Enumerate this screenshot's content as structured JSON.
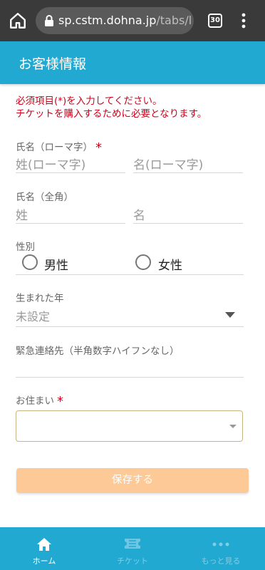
{
  "browser": {
    "url_host": "sp.cstm.dohna.jp",
    "url_path": "/tabs/l",
    "tab_count": "30"
  },
  "header": {
    "title": "お客様情報"
  },
  "notice": {
    "line1": "必須項目(*)を入力してください。",
    "line2": "チケットを購入するために必要となります。"
  },
  "form": {
    "name_roman": {
      "label": "氏名（ローマ字）",
      "required_mark": "*",
      "last_placeholder": "姓(ローマ字)",
      "first_placeholder": "名(ローマ字)"
    },
    "name_full": {
      "label": "氏名（全角）",
      "last_placeholder": "姓",
      "first_placeholder": "名"
    },
    "gender": {
      "label": "性別",
      "options": [
        "男性",
        "女性"
      ]
    },
    "birth_year": {
      "label": "生まれた年",
      "value": "未設定"
    },
    "emergency": {
      "label": "緊急連絡先（半角数字ハイフンなし）",
      "value": ""
    },
    "address": {
      "label": "お住まい",
      "required_mark": "*",
      "value": ""
    },
    "save_label": "保存する"
  },
  "bottom_nav": {
    "items": [
      {
        "label": "ホーム",
        "icon": "home-icon",
        "active": true
      },
      {
        "label": "チケット",
        "icon": "ticket-icon",
        "active": false
      },
      {
        "label": "もっと見る",
        "icon": "more-dots-icon",
        "active": false
      }
    ]
  },
  "colors": {
    "accent": "#21a9d1",
    "required": "#d0021b",
    "button_disabled": "#fdc996",
    "browser_bar": "#3a3a3a"
  }
}
